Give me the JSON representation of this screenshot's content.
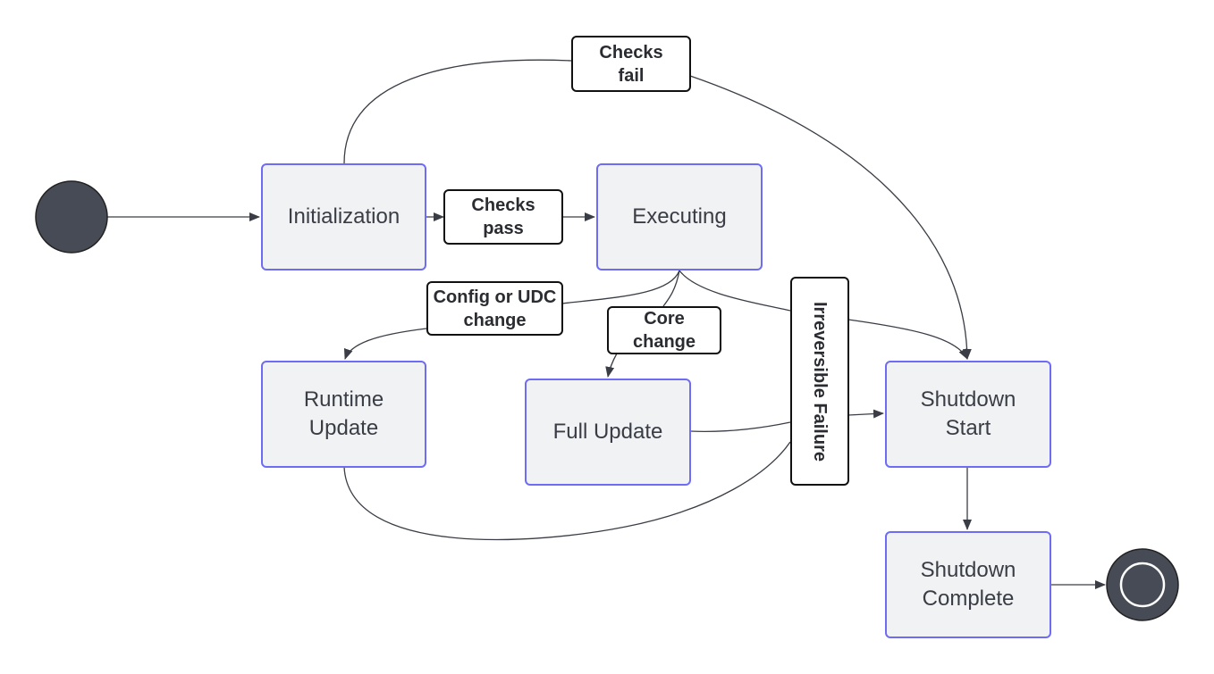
{
  "states": {
    "initialization": "Initialization",
    "executing": "Executing",
    "runtime_update": "Runtime Update",
    "full_update": "Full Update",
    "shutdown_start": "Shutdown Start",
    "shutdown_complete": "Shutdown Complete"
  },
  "transitions": {
    "checks_fail": "Checks fail",
    "checks_pass": "Checks pass",
    "config_change": "Config or UDC change",
    "core_change": "Core change",
    "irreversible_failure": "Irreversible Failure"
  },
  "colors": {
    "state_fill": "#f1f2f4",
    "state_border": "#6e6cf5",
    "node_fill": "#474b55",
    "edge": "#3a3d45"
  }
}
